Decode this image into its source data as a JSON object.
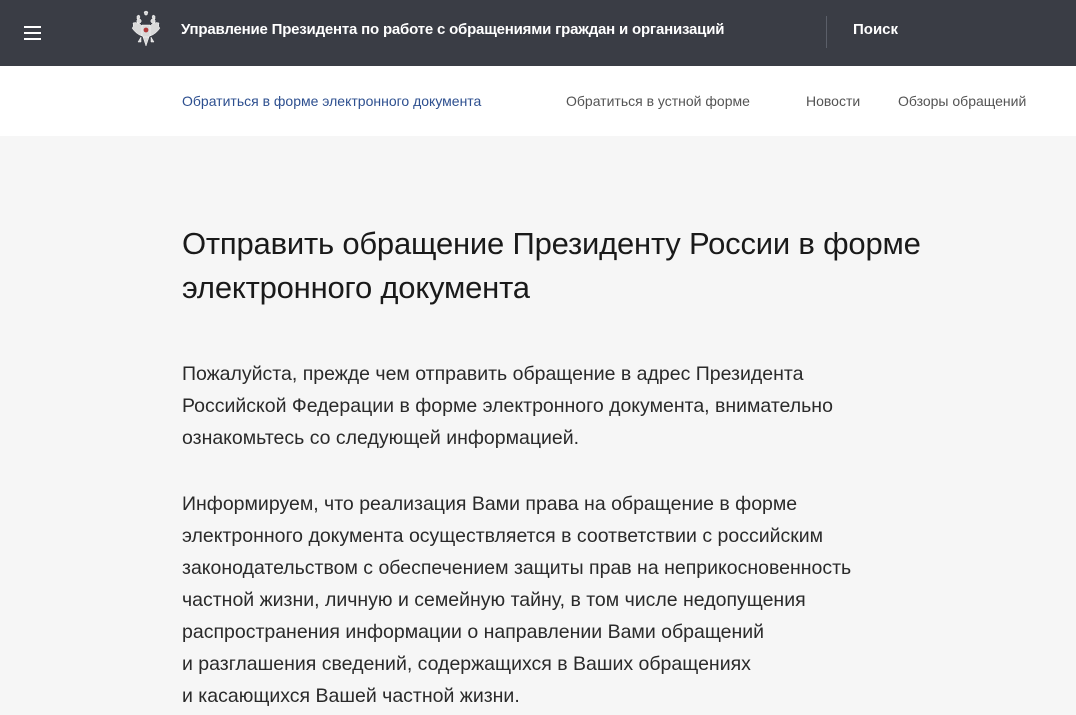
{
  "header": {
    "menu_icon": "hamburger-icon",
    "emblem_icon": "double-headed-eagle-emblem",
    "site_title": "Управление Президента по работе с обращениями граждан и организаций",
    "search_label": "Поиск"
  },
  "nav": {
    "items": [
      {
        "label": "Обратиться в форме электронного документа",
        "active": true
      },
      {
        "label": "Обратиться в устной форме",
        "active": false
      },
      {
        "label": "Новости",
        "active": false
      },
      {
        "label": "Обзоры обращений",
        "active": false
      }
    ]
  },
  "main": {
    "title": "Отправить обращение Президенту России в форме электронного документа",
    "title_lines": [
      "Отправить обращение Президенту России в форме",
      "электронного документа"
    ],
    "paragraph_1_lines": [
      "Пожалуйста, прежде чем отправить обращение в адрес Президента",
      "Российской Федерации в форме электронного документа, внимательно",
      "ознакомьтесь со следующей информацией."
    ],
    "paragraph_2_lines": [
      "Информируем, что реализация Вами права на обращение в форме",
      "электронного документа осуществляется в соответствии с российским",
      "законодательством с обеспечением защиты прав на неприкосновенность",
      "частной жизни, личную и семейную тайну, в том числе недопущения",
      "распространения информации о направлении Вами обращений",
      "и разглашения сведений, содержащихся в Ваших обращениях",
      "и касающихся Вашей частной жизни."
    ]
  },
  "colors": {
    "header_bg": "#3a3d45",
    "page_bg": "#f6f6f6",
    "active_link": "#2d4f8f",
    "nav_text": "#545454"
  }
}
